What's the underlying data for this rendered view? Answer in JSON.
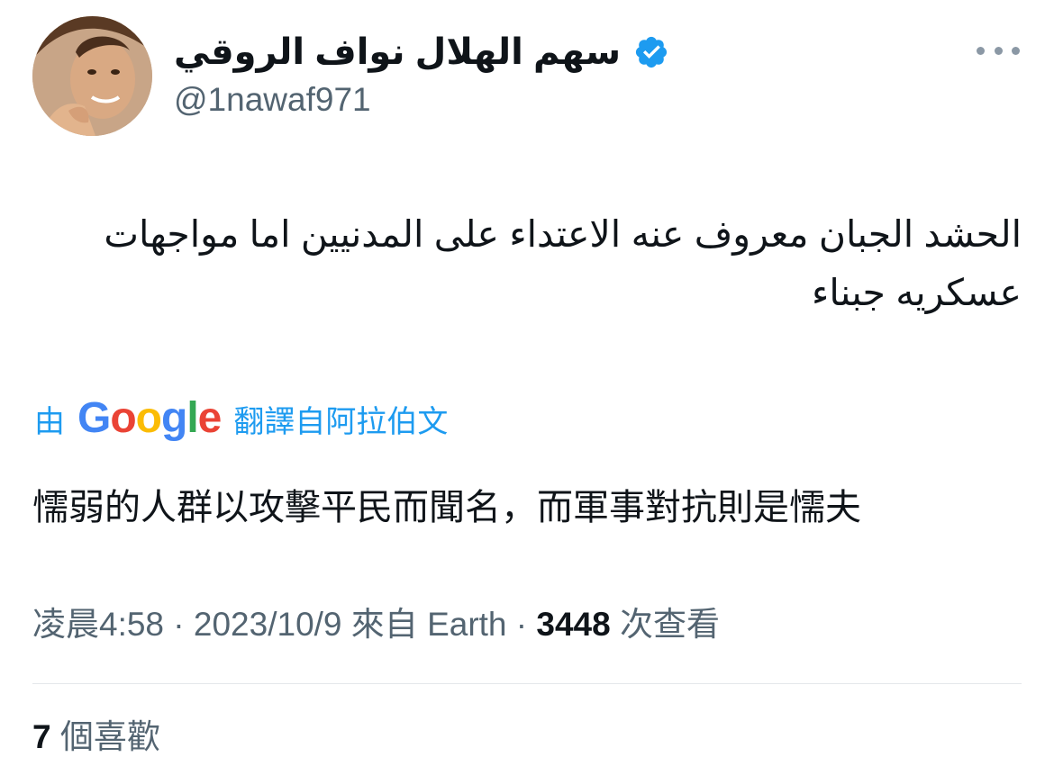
{
  "author": {
    "display_name": "سهم الهلال نواف الروقي",
    "handle": "@1nawaf971",
    "verified": true,
    "verified_color": "#1d9bf0"
  },
  "tweet": {
    "text": "الحشد الجبان معروف عنه الاعتداء على المدنيين اما مواجهات عسكريه جبناء",
    "translate": {
      "prefix": "由",
      "provider": "Google",
      "suffix": "翻譯自阿拉伯文"
    },
    "translated_text": "懦弱的人群以攻擊平民而聞名，而軍事對抗則是懦夫"
  },
  "meta": {
    "time": "凌晨4:58",
    "sep1": " · ",
    "date": "2023/10/9",
    "source": " 來自 Earth",
    "sep2": " · ",
    "views_count": "3448",
    "views_label": " 次查看"
  },
  "engagement": {
    "likes_count": "7",
    "likes_label": " 個喜歡"
  },
  "colors": {
    "link": "#1d9bf0",
    "secondary_text": "#536471",
    "primary_text": "#0f1419",
    "divider": "#e5e8eb"
  },
  "icons": {
    "verified": "verified-badge-icon",
    "more": "more-options-icon"
  }
}
